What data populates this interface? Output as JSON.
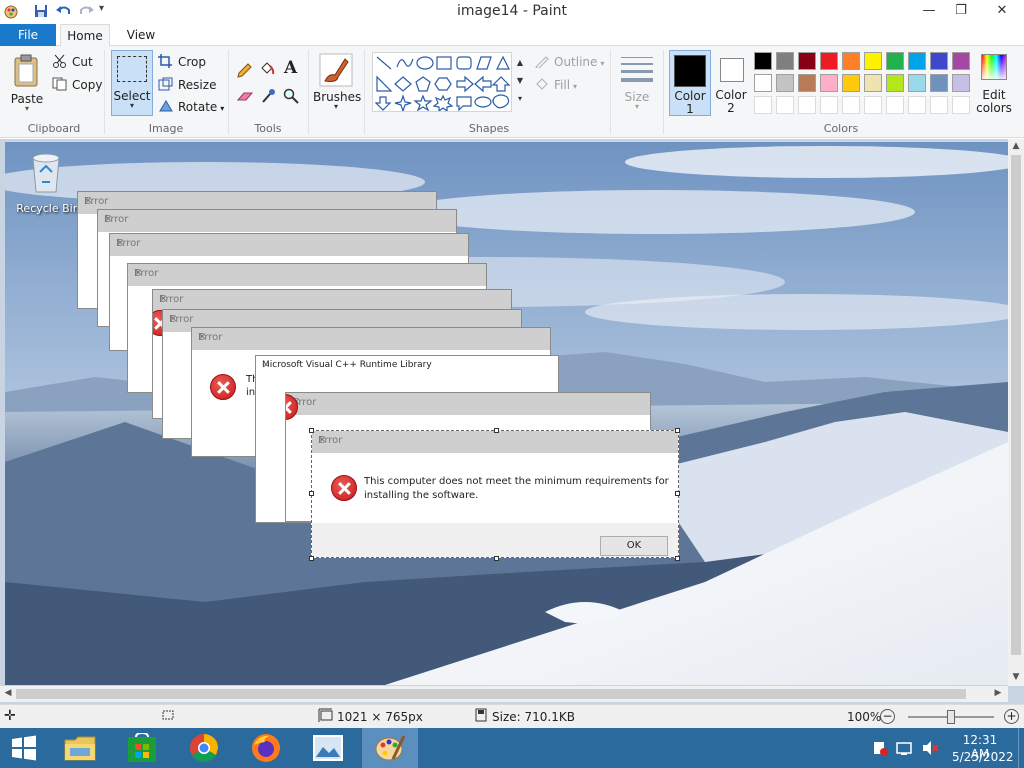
{
  "window": {
    "title": "image14 - Paint",
    "minimize": "—",
    "restore": "❐",
    "close": "✕"
  },
  "tabs": [
    {
      "label": "File"
    },
    {
      "label": "Home"
    },
    {
      "label": "View"
    }
  ],
  "ribbon": {
    "clipboard": {
      "paste": "Paste",
      "cut": "Cut",
      "copy": "Copy",
      "group": "Clipboard"
    },
    "image": {
      "select": "Select",
      "crop": "Crop",
      "resize": "Resize",
      "rotate": "Rotate",
      "group": "Image"
    },
    "tools": {
      "group": "Tools"
    },
    "brushes": {
      "label": "Brushes"
    },
    "shapes": {
      "outline": "Outline",
      "fill": "Fill",
      "group": "Shapes"
    },
    "size": {
      "label": "Size"
    },
    "colors": {
      "color1": "Color",
      "color1_num": "1",
      "color2": "Color",
      "color2_num": "2",
      "edit1": "Edit",
      "edit2": "colors",
      "group": "Colors",
      "palette_row1": [
        "#000000",
        "#7f7f7f",
        "#880015",
        "#ed1c24",
        "#ff7f27",
        "#fff200",
        "#22b14c",
        "#00a2e8",
        "#3f48cc",
        "#a349a4"
      ],
      "palette_row2": [
        "#ffffff",
        "#c3c3c3",
        "#b97a57",
        "#ffaec9",
        "#ffc90e",
        "#efe4b0",
        "#b5e61d",
        "#99d9ea",
        "#7092be",
        "#c8bfe7"
      ]
    }
  },
  "desktop": {
    "recycle_bin": "Recycle Bin"
  },
  "dialogs": {
    "error_title": "Error",
    "runtime_title": "Microsoft Visual C++ Runtime Library",
    "partial_text_1": "Th",
    "partial_text_2": "ins",
    "message_line1": "This computer does not meet the minimum requirements for",
    "message_line2": "installing the software.",
    "ok": "OK"
  },
  "status": {
    "dimensions": "1021 × 765px",
    "size": "Size: 710.1KB",
    "zoom": "100%"
  },
  "taskbar": {
    "time": "12:31 AM",
    "date": "5/25/2022"
  }
}
